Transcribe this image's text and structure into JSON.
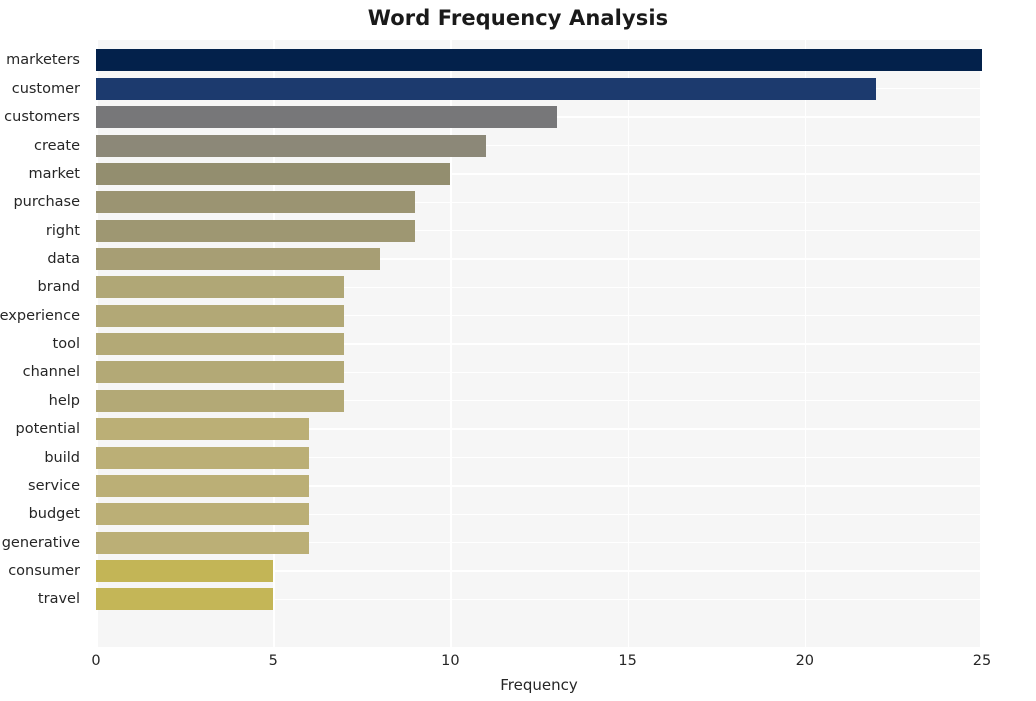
{
  "chart_data": {
    "type": "bar",
    "orientation": "horizontal",
    "title": "Word Frequency Analysis",
    "xlabel": "Frequency",
    "ylabel": "",
    "categories": [
      "marketers",
      "customer",
      "customers",
      "create",
      "market",
      "purchase",
      "right",
      "data",
      "brand",
      "experience",
      "tool",
      "channel",
      "help",
      "potential",
      "build",
      "service",
      "budget",
      "generative",
      "consumer",
      "travel"
    ],
    "values": [
      25,
      22,
      13,
      11,
      10,
      9,
      9,
      8,
      7,
      7,
      7,
      7,
      7,
      6,
      6,
      6,
      6,
      6,
      5,
      5
    ],
    "bar_colors": [
      "#03214b",
      "#1c3a6e",
      "#777779",
      "#8c8878",
      "#938e6f",
      "#9b9472",
      "#9e9772",
      "#a79e74",
      "#b0a776",
      "#b2a876",
      "#b3a976",
      "#b3a976",
      "#b3a976",
      "#bbaf76",
      "#bbaf76",
      "#bbaf76",
      "#bbaf76",
      "#bbaf76",
      "#c3b556",
      "#c4b657"
    ],
    "xticks": [
      0,
      5,
      10,
      15,
      20,
      25
    ],
    "xlim": [
      0,
      25
    ],
    "grid": true,
    "grid_color": "#ffffff",
    "plot_background": "#f6f6f6",
    "legend": "none"
  }
}
